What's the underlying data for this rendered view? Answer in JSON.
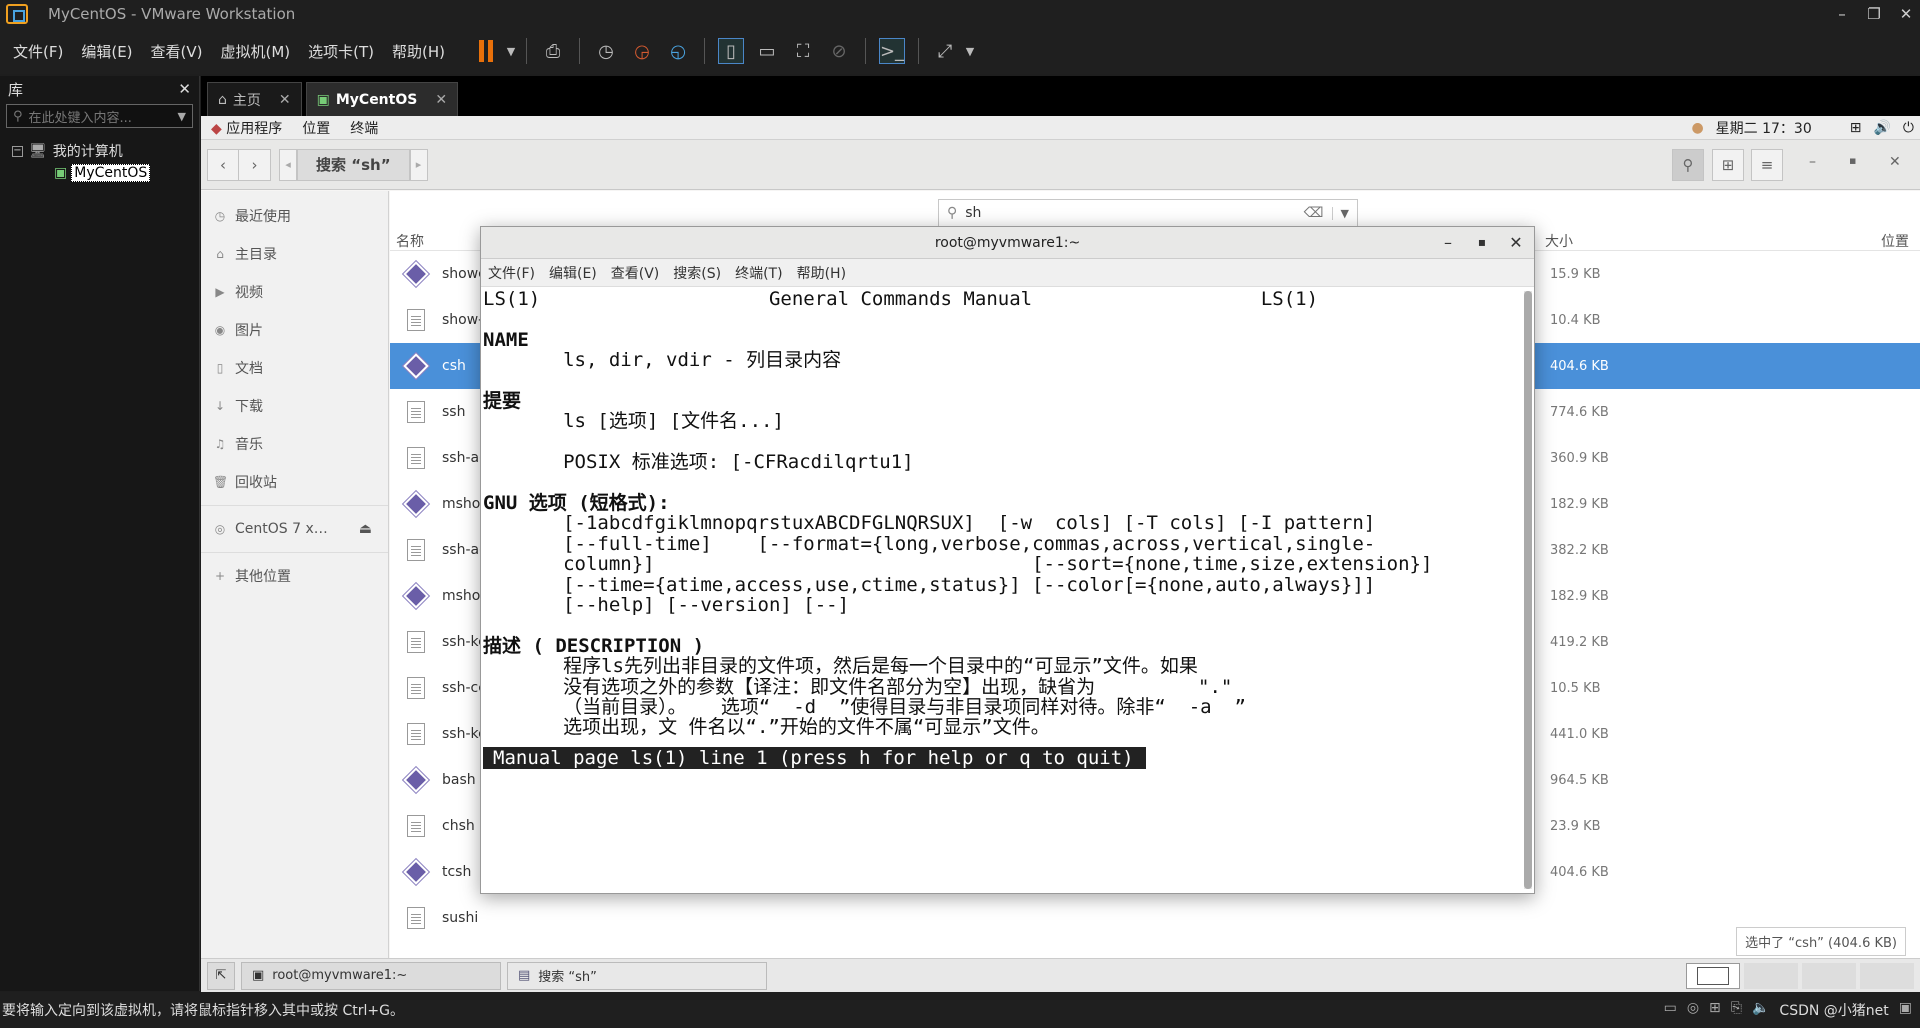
{
  "window": {
    "title": "MyCentOS - VMware Workstation"
  },
  "menubar": {
    "items": [
      "文件(F)",
      "编辑(E)",
      "查看(V)",
      "虚拟机(M)",
      "选项卡(T)",
      "帮助(H)"
    ]
  },
  "library": {
    "title": "库",
    "search_placeholder": "在此处键入内容...",
    "tree_root": "我的计算机",
    "tree_vm": "MyCentOS"
  },
  "tabs": [
    {
      "label": "主页"
    },
    {
      "label": "MyCentOS"
    }
  ],
  "guest_top": {
    "apps": "应用程序",
    "places": "位置",
    "terminal": "终端",
    "clock": "星期二 17：30"
  },
  "nautilus": {
    "path_label": "搜索 “sh”",
    "search_value": "sh",
    "col_name": "名称",
    "col_size": "大小",
    "col_location": "位置",
    "status": "选中了 “csh” (404.6 KB)",
    "places": [
      {
        "icon": "clock-icon",
        "label": "最近使用"
      },
      {
        "icon": "home-icon",
        "label": "主目录"
      },
      {
        "icon": "video-icon",
        "label": "视频"
      },
      {
        "icon": "camera-icon",
        "label": "图片"
      },
      {
        "icon": "document-icon",
        "label": "文档"
      },
      {
        "icon": "download-icon",
        "label": "下载"
      },
      {
        "icon": "music-icon",
        "label": "音乐"
      },
      {
        "icon": "trash-icon",
        "label": "回收站"
      },
      {
        "icon": "disc-icon",
        "label": "CentOS 7 x…"
      },
      {
        "icon": "plus-icon",
        "label": "其他位置"
      }
    ],
    "files": [
      {
        "name": "showc",
        "size": "15.9 KB",
        "icon": "executable"
      },
      {
        "name": "show-",
        "size": "10.4 KB",
        "icon": "doc"
      },
      {
        "name": "csh",
        "size": "404.6 KB",
        "icon": "executable",
        "selected": true
      },
      {
        "name": "ssh",
        "size": "774.6 KB",
        "icon": "doc"
      },
      {
        "name": "ssh-ac",
        "size": "360.9 KB",
        "icon": "doc"
      },
      {
        "name": "mshov",
        "size": "182.9 KB",
        "icon": "executable"
      },
      {
        "name": "ssh-ag",
        "size": "382.2 KB",
        "icon": "doc"
      },
      {
        "name": "mshor",
        "size": "182.9 KB",
        "icon": "executable"
      },
      {
        "name": "ssh-ke",
        "size": "419.2 KB",
        "icon": "doc"
      },
      {
        "name": "ssh-cc",
        "size": "10.5 KB",
        "icon": "doc"
      },
      {
        "name": "ssh-ke",
        "size": "441.0 KB",
        "icon": "doc"
      },
      {
        "name": "bash",
        "size": "964.5 KB",
        "icon": "executable"
      },
      {
        "name": "chsh",
        "size": "23.9 KB",
        "icon": "doc"
      },
      {
        "name": "tcsh",
        "size": "404.6 KB",
        "icon": "executable"
      },
      {
        "name": "sushi",
        "size": "",
        "icon": "doc"
      }
    ]
  },
  "terminal": {
    "title": "root@myvmware1:~",
    "menu": [
      "文件(F)",
      "编辑(E)",
      "查看(V)",
      "搜索(S)",
      "终端(T)",
      "帮助(H)"
    ],
    "lines": [
      "LS(1)                    General Commands Manual                    LS(1)",
      "",
      "NAME",
      "       ls, dir, vdir - 列目录内容",
      "",
      "提要",
      "       ls [选项] [文件名...]",
      "",
      "       POSIX 标准选项: [-CFRacdilqrtu1]",
      "",
      "GNU 选项 (短格式):",
      "       [-1abcdfgiklmnopqrstuxABCDFGLNQRSUX]  [-w  cols] [-T cols] [-I pattern]",
      "       [--full-time]    [--format={long,verbose,commas,across,vertical,single-",
      "       column}]                                 [--sort={none,time,size,extension}]",
      "       [--time={atime,access,use,ctime,status}] [--color[={none,auto,always}]]",
      "       [--help] [--version] [--]",
      "",
      "描述 ( DESCRIPTION )",
      "       程序ls先列出非目录的文件项，然后是每一个目录中的“可显示”文件。如果",
      "       没有选项之外的参数【译注：即文件名部分为空】出现，缺省为         \".\"",
      "       （当前目录）。   选项“  -d  ”使得目录与非目录项同样对待。除非“  -a  ”",
      "       选项出现，文 件名以“.”开始的文件不属“可显示”文件。"
    ],
    "status_line": "Manual page ls(1) line 1 (press h for help or q to quit)"
  },
  "taskbar": {
    "item1": "root@myvmware1:~",
    "item2": "搜索 “sh”"
  },
  "vm_status": {
    "message": "要将输入定向到该虚拟机，请将鼠标指针移入其中或按 Ctrl+G。",
    "watermark": "CSDN @小猪net"
  }
}
